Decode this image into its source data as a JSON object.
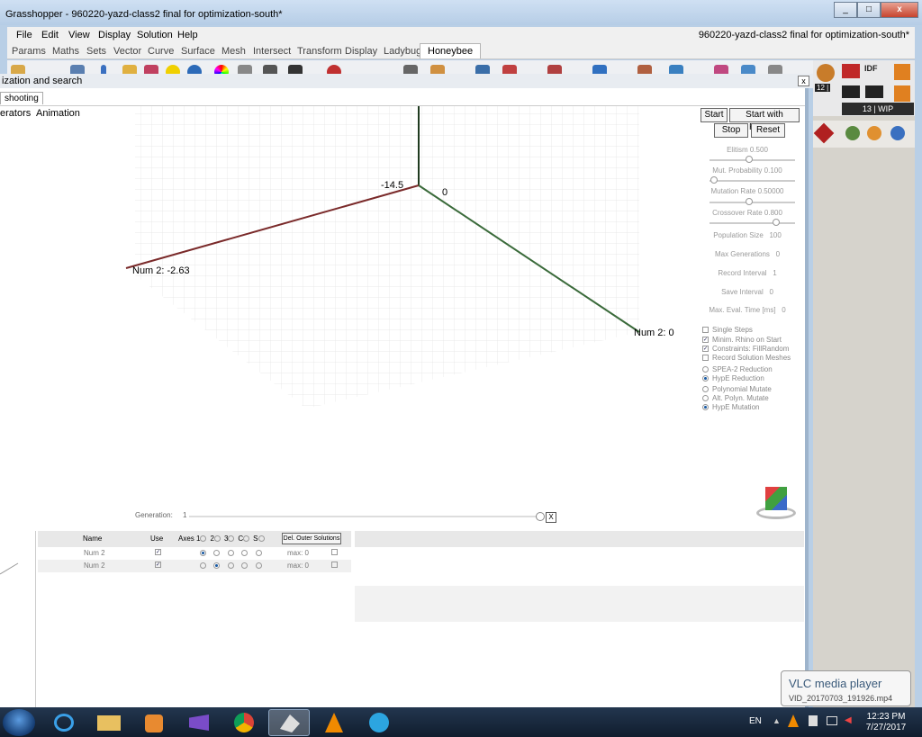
{
  "window": {
    "title": "Grasshopper - 960220-yazd-class2 final for optimization-south*",
    "document_name": "960220-yazd-class2 final for optimization-south*",
    "controls": [
      "_",
      "□",
      "x"
    ]
  },
  "menu": [
    "File",
    "Edit",
    "View",
    "Display",
    "Solution",
    "Help"
  ],
  "tabs": [
    "Params",
    "Maths",
    "Sets",
    "Vector",
    "Curve",
    "Surface",
    "Mesh",
    "Intersect",
    "Transform",
    "Display",
    "Ladybug",
    "Honeybee"
  ],
  "active_tab": "Honeybee",
  "ribbon_right": {
    "badge_12": "12 |",
    "wip": "13 | WIP",
    "idf": "IDF"
  },
  "dialog": {
    "title": "ization and search",
    "close": "x",
    "tab": "shooting",
    "subtabs": [
      "erators",
      "Animation"
    ],
    "plot": {
      "axis_label_x": "Num 2: -2.63",
      "axis_label_y": "Num 2: 0",
      "corner_label_a": "-14.5",
      "corner_label_b": "0"
    },
    "buttons": {
      "start": "Start",
      "start_presets": "Start with Presets",
      "stop": "Stop",
      "reset": "Reset"
    },
    "params": [
      {
        "label": "Elitism",
        "value": "0.500",
        "slider": 0.5
      },
      {
        "label": "Mut. Probability",
        "value": "0.100",
        "slider": 0.1
      },
      {
        "label": "Mutation Rate",
        "value": "0.50000",
        "slider": 0.5
      },
      {
        "label": "Crossover Rate",
        "value": "0.800",
        "slider": 0.8
      }
    ],
    "settings": [
      {
        "label": "Population Size",
        "value": "100"
      },
      {
        "label": "Max Generations",
        "value": "0"
      },
      {
        "label": "Record Interval",
        "value": "1"
      },
      {
        "label": "Save Interval",
        "value": "0"
      },
      {
        "label": "Max. Eval. Time [ms]",
        "value": "0"
      }
    ],
    "checkboxes": [
      {
        "label": "Single Steps",
        "checked": false
      },
      {
        "label": "Minim. Rhino on Start",
        "checked": true
      },
      {
        "label": "Constraints: FillRandom",
        "checked": true
      },
      {
        "label": "Record Solution Meshes",
        "checked": false
      }
    ],
    "radios_a": [
      {
        "label": "SPEA-2 Reduction",
        "on": false
      },
      {
        "label": "HypE Reduction",
        "on": true
      }
    ],
    "radios_b": [
      {
        "label": "Polynomial Mutate",
        "on": false
      },
      {
        "label": "Alt. Polyn. Mutate",
        "on": false
      },
      {
        "label": "HypE Mutation",
        "on": true
      }
    ],
    "generation_label": "Generation:",
    "generation_value": "1",
    "generation_close": "X",
    "table": {
      "headers": {
        "name": "Name",
        "use": "Use",
        "axes": "Axes",
        "a1": "1",
        "a2": "2",
        "a3": "3",
        "ac": "C",
        "as": "S",
        "del": "Del. Outer Solutions"
      },
      "rows": [
        {
          "name": "Num 2",
          "use": true,
          "axis": 1,
          "max": "max: 0"
        },
        {
          "name": "Num 2",
          "use": true,
          "axis": 2,
          "max": "max: 0"
        }
      ]
    }
  },
  "tooltip": {
    "title": "VLC media player",
    "file": "VID_20170703_191926.mp4"
  },
  "taskbar": {
    "lang": "EN",
    "time": "12:23 PM",
    "date": "7/27/2017"
  }
}
